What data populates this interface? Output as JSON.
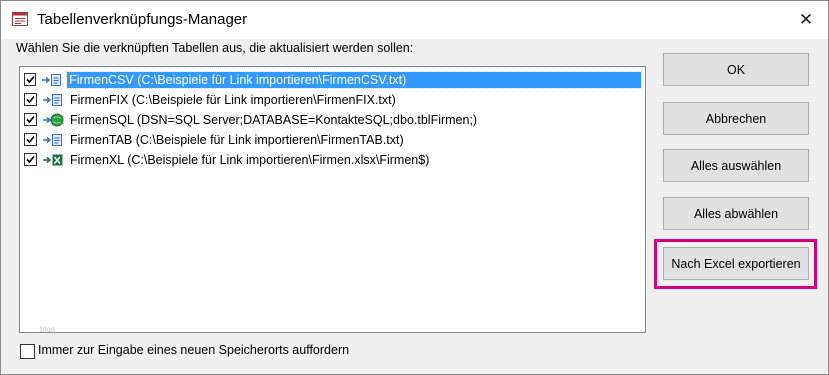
{
  "window": {
    "title": "Tabellenverknüpfungs-Manager"
  },
  "instruction": "Wählen Sie die verknüpften Tabellen aus, die aktualisiert werden sollen:",
  "tables": [
    {
      "label": "FirmenCSV (C:\\Beispiele für Link importieren\\FirmenCSV.txt)",
      "checked": true,
      "icon": "text-link-icon",
      "selected": true
    },
    {
      "label": "FirmenFIX (C:\\Beispiele für Link importieren\\FirmenFIX.txt)",
      "checked": true,
      "icon": "text-link-icon",
      "selected": false
    },
    {
      "label": "FirmenSQL (DSN=SQL Server;DATABASE=KontakteSQL;dbo.tblFirmen;)",
      "checked": true,
      "icon": "odbc-globe-icon",
      "selected": false
    },
    {
      "label": "FirmenTAB (C:\\Beispiele für Link importieren\\FirmenTAB.txt)",
      "checked": true,
      "icon": "text-link-icon",
      "selected": false
    },
    {
      "label": "FirmenXL (C:\\Beispiele für Link importieren\\Firmen.xlsx\\Firmen$)",
      "checked": true,
      "icon": "excel-link-icon",
      "selected": false
    }
  ],
  "watermark": "blog",
  "buttons": {
    "ok": "OK",
    "cancel": "Abbrechen",
    "select_all": "Alles auswählen",
    "deselect_all": "Alles abwählen",
    "export_excel": "Nach Excel exportieren"
  },
  "footer": {
    "checkbox_label": "Immer zur Eingabe eines neuen Speicherorts auffordern",
    "checked": false
  },
  "colors": {
    "selection": "#3399ff",
    "highlight_frame": "#d5007f",
    "excel_green": "#1e7145"
  }
}
